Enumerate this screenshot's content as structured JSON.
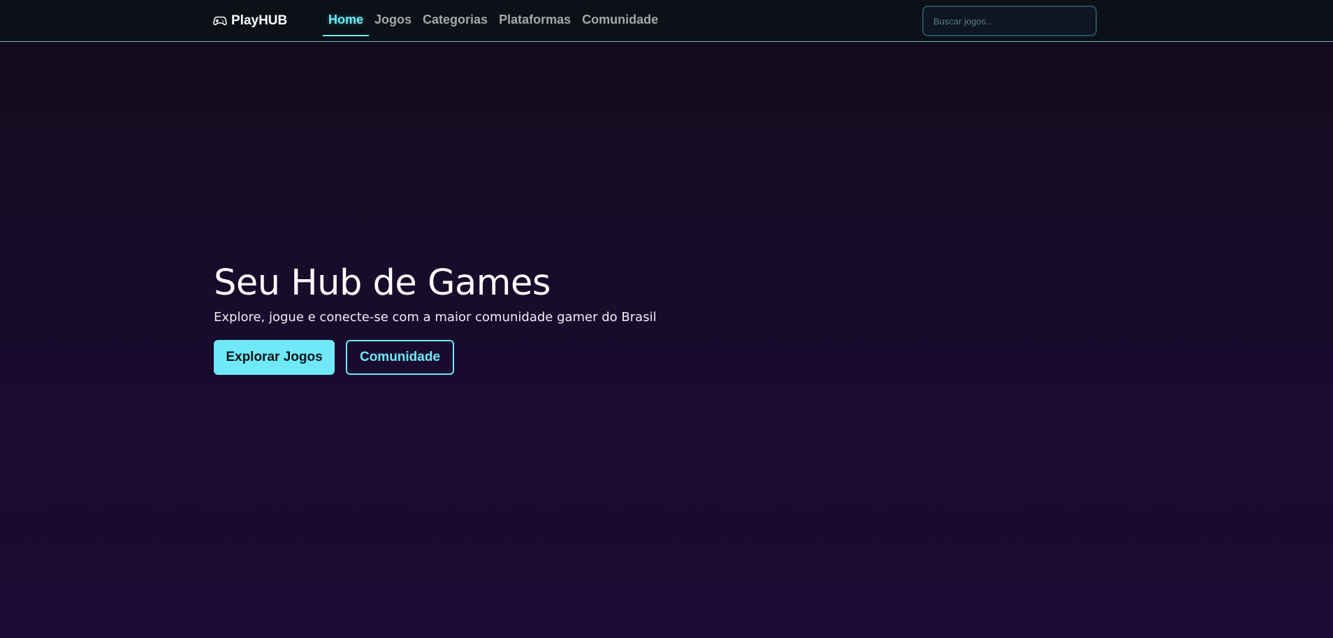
{
  "navbar": {
    "brand": {
      "icon": "gamepad-icon",
      "label": "PlayHUB"
    },
    "items": [
      {
        "label": "Home",
        "active": true
      },
      {
        "label": "Jogos",
        "active": false
      },
      {
        "label": "Categorias",
        "active": false
      },
      {
        "label": "Plataformas",
        "active": false
      },
      {
        "label": "Comunidade",
        "active": false
      }
    ],
    "search": {
      "placeholder": "Buscar jogos...",
      "value": ""
    }
  },
  "hero": {
    "title": "Seu Hub de Games",
    "subtitle": "Explore, jogue e conecte-se com a maior comunidade gamer do Brasil",
    "primary_button": "Explorar Jogos",
    "secondary_button": "Comunidade"
  },
  "colors": {
    "accent": "#6fe9f7",
    "navbar_bg": "#0b1117",
    "background_top": "#110b19",
    "background_bottom": "#1b0a33",
    "nav_inactive": "#a4a8ad",
    "search_border": "#27505c"
  }
}
